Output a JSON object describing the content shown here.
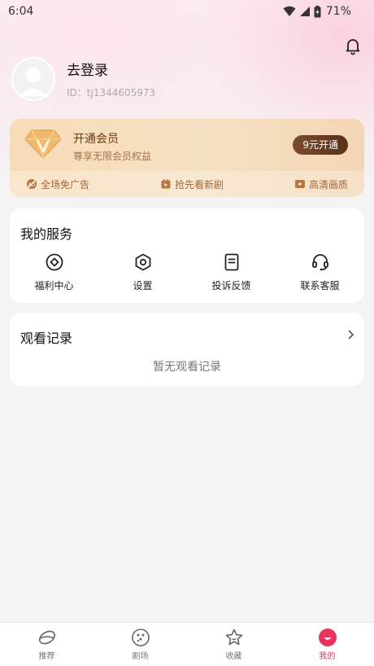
{
  "status_bar": {
    "time": "6:04",
    "battery": "71%"
  },
  "profile": {
    "login_label": "去登录",
    "user_id": "ID：tj1344605973"
  },
  "vip": {
    "title": "开通会员",
    "subtitle": "尊享无限会员权益",
    "button": "9元开通",
    "perks": [
      "全场免广告",
      "抢先看新剧",
      "高清画质"
    ]
  },
  "services": {
    "title": "我的服务",
    "items": [
      {
        "label": "福利中心",
        "icon": "welfare-icon"
      },
      {
        "label": "设置",
        "icon": "settings-icon"
      },
      {
        "label": "投诉反馈",
        "icon": "feedback-icon"
      },
      {
        "label": "联系客服",
        "icon": "headset-icon"
      }
    ]
  },
  "history": {
    "title": "观看记录",
    "empty": "暂无观看记录"
  },
  "tabs": [
    {
      "label": "推荐",
      "icon": "recommend-icon"
    },
    {
      "label": "剧场",
      "icon": "theater-icon"
    },
    {
      "label": "收藏",
      "icon": "star-icon"
    },
    {
      "label": "我的",
      "icon": "profile-icon",
      "active": true
    }
  ],
  "colors": {
    "accent": "#e8335c",
    "vip_gold": "#f6dcb8",
    "vip_text": "#6a3a15"
  }
}
